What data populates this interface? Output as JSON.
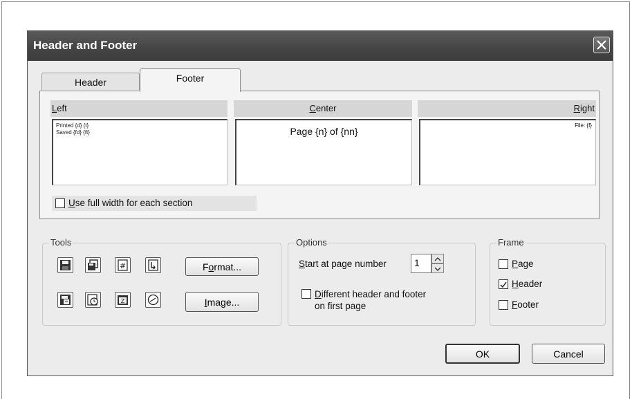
{
  "dialog": {
    "title": "Header and Footer",
    "tabs": [
      {
        "label": "Header"
      },
      {
        "label": "Footer"
      }
    ],
    "sections": {
      "left": {
        "label_mnemonic": "L",
        "label_rest": "eft",
        "lines": [
          "Printed {d} {t}",
          "Saved {fd} {ft}"
        ]
      },
      "center": {
        "label_mnemonic": "C",
        "label_rest": "enter",
        "text": "Page {n} of {nn}"
      },
      "right": {
        "label_mnemonic": "R",
        "label_rest": "ight",
        "text": "File: {f}"
      }
    },
    "full_width": {
      "mnemonic": "U",
      "rest": "se full width for each section",
      "checked": false
    },
    "tools": {
      "title": "Tools",
      "icons_row1": [
        "save-icon",
        "save-all-icon",
        "page-number-icon",
        "page-count-icon"
      ],
      "icons_row2": [
        "file-date-icon",
        "file-time-icon",
        "date-icon",
        "time-icon"
      ],
      "format_button": {
        "pre": "F",
        "mnemonic": "o",
        "post": "rmat..."
      },
      "image_button": {
        "pre": "",
        "mnemonic": "I",
        "post": "mage..."
      }
    },
    "options": {
      "title": "Options",
      "start_label_mnemonic": "S",
      "start_label_rest": "tart at page number",
      "start_value": "1",
      "different_first": {
        "mnemonic": "D",
        "rest_line1": "ifferent header and footer",
        "line2": "on first page",
        "checked": false
      }
    },
    "frame": {
      "title": "Frame",
      "page": {
        "mnemonic": "P",
        "rest": "age",
        "checked": false
      },
      "header": {
        "mnemonic": "H",
        "rest": "eader",
        "checked": true
      },
      "footer": {
        "mnemonic": "F",
        "rest": "ooter",
        "checked": false
      }
    },
    "ok_label": "OK",
    "cancel_label": "Cancel"
  }
}
